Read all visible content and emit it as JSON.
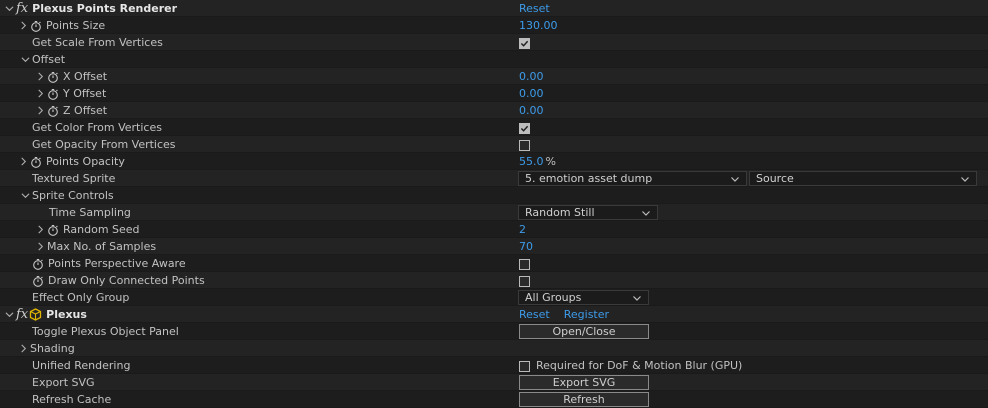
{
  "effect1": {
    "title": "Plexus Points Renderer",
    "reset": "Reset",
    "points_size": {
      "label": "Points Size",
      "value": "130.00"
    },
    "get_scale": {
      "label": "Get Scale From Vertices",
      "checked": true
    },
    "offset": {
      "label": "Offset"
    },
    "x_offset": {
      "label": "X Offset",
      "value": "0.00"
    },
    "y_offset": {
      "label": "Y Offset",
      "value": "0.00"
    },
    "z_offset": {
      "label": "Z Offset",
      "value": "0.00"
    },
    "get_color": {
      "label": "Get Color From Vertices",
      "checked": true
    },
    "get_opacity": {
      "label": "Get Opacity From Vertices",
      "checked": false
    },
    "points_opacity": {
      "label": "Points Opacity",
      "value": "55.0",
      "unit": "%"
    },
    "textured_sprite": {
      "label": "Textured Sprite",
      "layer": "5. emotion asset dump",
      "source": "Source"
    },
    "sprite_controls": {
      "label": "Sprite Controls"
    },
    "time_sampling": {
      "label": "Time Sampling",
      "value": "Random Still"
    },
    "random_seed": {
      "label": "Random Seed",
      "value": "2"
    },
    "max_samples": {
      "label": "Max No. of Samples",
      "value": "70"
    },
    "perspective": {
      "label": "Points Perspective Aware",
      "checked": false
    },
    "connected": {
      "label": "Draw Only Connected Points",
      "checked": false
    },
    "effect_group": {
      "label": "Effect Only Group",
      "value": "All Groups"
    }
  },
  "effect2": {
    "title": "Plexus",
    "reset": "Reset",
    "register": "Register",
    "toggle_panel": {
      "label": "Toggle Plexus Object Panel",
      "button": "Open/Close"
    },
    "shading": {
      "label": "Shading"
    },
    "unified": {
      "label": "Unified Rendering",
      "checkbox_label": "Required for DoF & Motion Blur (GPU)",
      "checked": false
    },
    "export_svg": {
      "label": "Export SVG",
      "button": "Export SVG"
    },
    "refresh_cache": {
      "label": "Refresh Cache",
      "button": "Refresh"
    }
  },
  "colors": {
    "link": "#3d9be9",
    "background": "#232323",
    "row_dark": "#1d1d1d"
  }
}
